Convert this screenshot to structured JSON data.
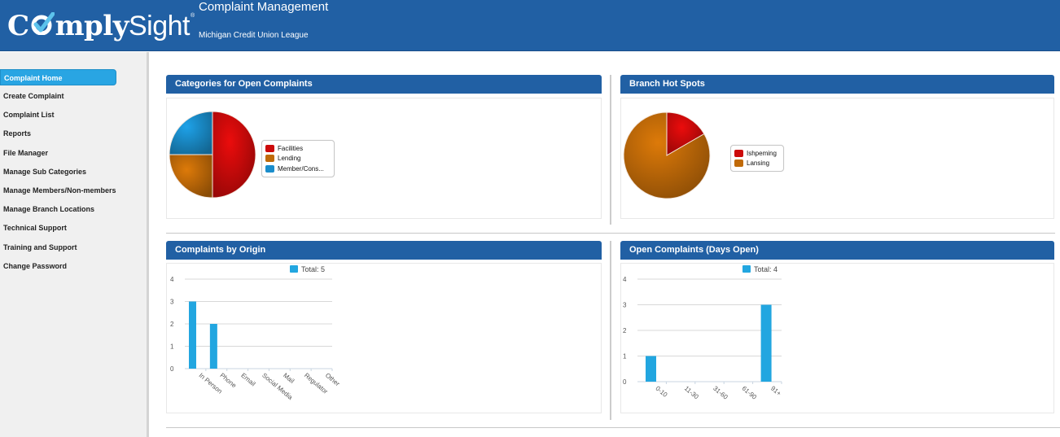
{
  "header": {
    "logo_text_1": "C",
    "logo_text_2": "mply",
    "logo_text_3": "Sight",
    "logo_registered": "®",
    "title": "Complaint Management",
    "organization": "Michigan Credit Union League"
  },
  "sidebar": {
    "items": [
      {
        "label": "Complaint Home",
        "active": true
      },
      {
        "label": "Create Complaint"
      },
      {
        "label": "Complaint List"
      },
      {
        "label": "Reports"
      },
      {
        "label": "File Manager"
      },
      {
        "label": "Manage Sub Categories"
      },
      {
        "label": "Manage Members/Non-members"
      },
      {
        "label": "Manage Branch Locations"
      },
      {
        "label": "Technical Support"
      },
      {
        "label": "Training and Support"
      },
      {
        "label": "Change Password"
      }
    ]
  },
  "colors": {
    "brand_blue": "#2160a4",
    "active_nav": "#29a5e3",
    "bar_blue": "#22a6e0",
    "slice_red": "#cc0a0a",
    "slice_orange": "#c06a08",
    "slice_blue": "#1a8dcb"
  },
  "panels": {
    "categories": {
      "title": "Categories for Open Complaints"
    },
    "branches": {
      "title": "Branch Hot Spots"
    },
    "origin": {
      "title": "Complaints by Origin"
    },
    "days": {
      "title": "Open Complaints (Days Open)"
    }
  },
  "chart_data": [
    {
      "id": "categories",
      "type": "pie",
      "title": "Categories for Open Complaints",
      "labels": [
        "Facilities",
        "Lending",
        "Member/Cons..."
      ],
      "values": [
        2,
        1,
        1
      ],
      "colors": [
        "#cc0a0a",
        "#c06a08",
        "#1a8dcb"
      ],
      "legend": "right"
    },
    {
      "id": "branches",
      "type": "pie",
      "title": "Branch Hot Spots",
      "labels": [
        "Ishpeming",
        "Lansing"
      ],
      "values": [
        1,
        5
      ],
      "colors": [
        "#cc0a0a",
        "#c06a08"
      ],
      "legend": "right"
    },
    {
      "id": "origin",
      "type": "bar",
      "title": "Complaints by Origin",
      "categories": [
        "In Person",
        "Phone",
        "Email",
        "Social Media",
        "Mail",
        "Regulator",
        "Other"
      ],
      "series": [
        {
          "name": "Total: 5",
          "values": [
            3,
            2,
            0,
            0,
            0,
            0,
            0
          ]
        }
      ],
      "yticks": [
        0,
        1,
        2,
        3,
        4
      ],
      "ylim": [
        0,
        4
      ],
      "grid": true,
      "legend": "top-right"
    },
    {
      "id": "days",
      "type": "bar",
      "title": "Open Complaints (Days Open)",
      "categories": [
        "0-10",
        "11-30",
        "31-60",
        "61-90",
        "91+"
      ],
      "series": [
        {
          "name": "Total: 4",
          "values": [
            1,
            0,
            0,
            0,
            3
          ]
        }
      ],
      "yticks": [
        0,
        1,
        2,
        3,
        4
      ],
      "ylim": [
        0,
        4
      ],
      "grid": true,
      "legend": "top-right"
    }
  ]
}
